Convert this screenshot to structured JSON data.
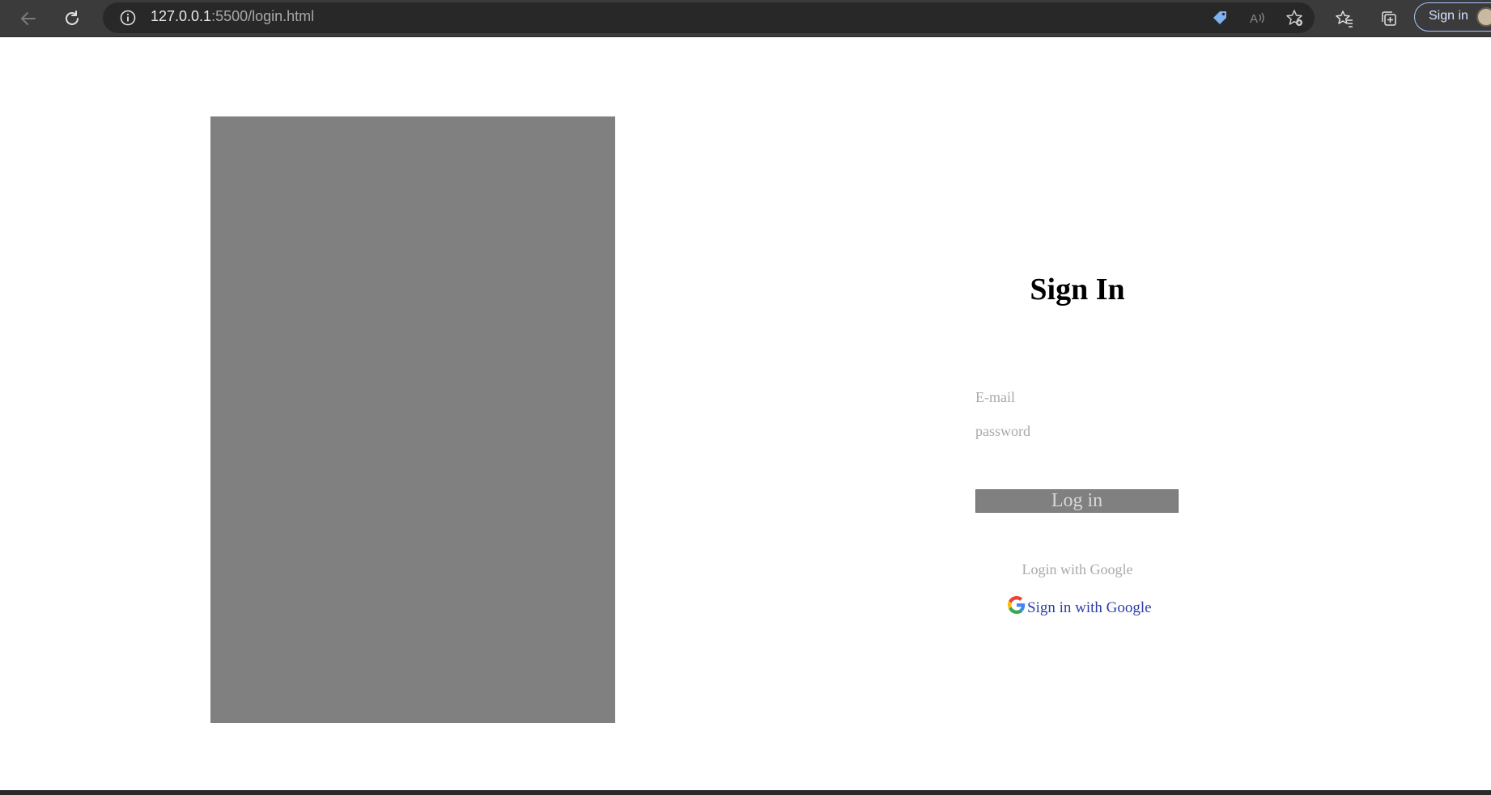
{
  "browser": {
    "url_host": "127.0.0.1",
    "url_rest": ":5500/login.html",
    "signin_label": "Sign in",
    "icons": [
      "back-arrow-icon",
      "reload-icon",
      "site-info-icon",
      "price-tag-icon",
      "read-aloud-icon",
      "add-favorite-icon",
      "favorites-icon",
      "collections-icon"
    ]
  },
  "page": {
    "title": "Sign In",
    "email_placeholder": "E-mail",
    "password_placeholder": "password",
    "login_button": "Log in",
    "google_label": "Login with Google",
    "google_link": "Sign in with Google"
  }
}
